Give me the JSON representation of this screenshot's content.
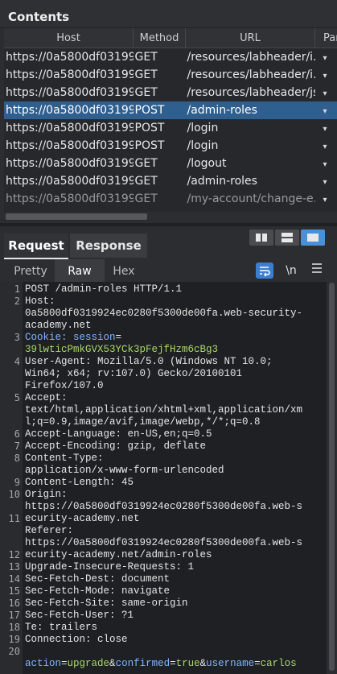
{
  "contents": {
    "title": "Contents",
    "columns": [
      "Host",
      "Method",
      "URL",
      "Par"
    ],
    "rows": [
      {
        "host": "https://0a5800df03199...",
        "method": "GET",
        "url": "/resources/labheader/i..."
      },
      {
        "host": "https://0a5800df03199...",
        "method": "GET",
        "url": "/resources/labheader/i..."
      },
      {
        "host": "https://0a5800df03199...",
        "method": "GET",
        "url": "/resources/labheader/js..."
      },
      {
        "host": "https://0a5800df03199...",
        "method": "POST",
        "url": "/admin-roles"
      },
      {
        "host": "https://0a5800df03199...",
        "method": "POST",
        "url": "/login"
      },
      {
        "host": "https://0a5800df03199...",
        "method": "POST",
        "url": "/login"
      },
      {
        "host": "https://0a5800df03199...",
        "method": "GET",
        "url": "/logout"
      },
      {
        "host": "https://0a5800df03199...",
        "method": "GET",
        "url": "/admin-roles"
      },
      {
        "host": "https://0a5800df03199...",
        "method": "GET",
        "url": "/my-account/change-e..."
      }
    ],
    "selected_row": 3
  },
  "tabs": {
    "request": "Request",
    "response": "Response"
  },
  "view": {
    "pretty": "Pretty",
    "raw": "Raw",
    "hex": "Hex",
    "newline_toggle": "\\n"
  },
  "request": {
    "line_numbers": [
      "1",
      "2",
      "",
      "",
      "3",
      "",
      "4",
      "",
      "",
      "5",
      "",
      "",
      "6",
      "7",
      "8",
      "",
      "9",
      "10",
      "",
      "11",
      "",
      "",
      "12",
      "13",
      "14",
      "15",
      "16",
      "17",
      "18",
      "19",
      "20"
    ],
    "lines": [
      [
        {
          "t": "POST /admin-roles HTTP/1.1"
        }
      ],
      [
        {
          "t": "Host:"
        }
      ],
      [
        {
          "t": "0a5800df0319924ec0280f5300de00fa.web-security-"
        }
      ],
      [
        {
          "t": "academy.net"
        }
      ],
      [
        {
          "t": "Cookie: ",
          "c": "k"
        },
        {
          "t": "session",
          "c": "k"
        },
        {
          "t": "="
        }
      ],
      [
        {
          "t": "39lwticPmkGVX53YCk3pFejfHzm6cBg3",
          "c": "g"
        }
      ],
      [
        {
          "t": "User-Agent: Mozilla/5.0 (Windows NT 10.0;"
        }
      ],
      [
        {
          "t": "Win64; x64; rv:107.0) Gecko/20100101"
        }
      ],
      [
        {
          "t": "Firefox/107.0"
        }
      ],
      [
        {
          "t": "Accept:"
        }
      ],
      [
        {
          "t": "text/html,application/xhtml+xml,application/xm"
        }
      ],
      [
        {
          "t": "l;q=0.9,image/avif,image/webp,*/*;q=0.8"
        }
      ],
      [
        {
          "t": "Accept-Language: en-US,en;q=0.5"
        }
      ],
      [
        {
          "t": "Accept-Encoding: gzip, deflate"
        }
      ],
      [
        {
          "t": "Content-Type:"
        }
      ],
      [
        {
          "t": "application/x-www-form-urlencoded"
        }
      ],
      [
        {
          "t": "Content-Length: 45"
        }
      ],
      [
        {
          "t": "Origin:"
        }
      ],
      [
        {
          "t": "https://0a5800df0319924ec0280f5300de00fa.web-s"
        }
      ],
      [
        {
          "t": "ecurity-academy.net"
        }
      ],
      [
        {
          "t": "Referer:"
        }
      ],
      [
        {
          "t": "https://0a5800df0319924ec0280f5300de00fa.web-s"
        }
      ],
      [
        {
          "t": "ecurity-academy.net/admin-roles"
        }
      ],
      [
        {
          "t": "Upgrade-Insecure-Requests: 1"
        }
      ],
      [
        {
          "t": "Sec-Fetch-Dest: document"
        }
      ],
      [
        {
          "t": "Sec-Fetch-Mode: navigate"
        }
      ],
      [
        {
          "t": "Sec-Fetch-Site: same-origin"
        }
      ],
      [
        {
          "t": "Sec-Fetch-User: ?1"
        }
      ],
      [
        {
          "t": "Te: trailers"
        }
      ],
      [
        {
          "t": "Connection: close"
        }
      ],
      [
        {
          "t": ""
        }
      ],
      [
        {
          "t": "action",
          "c": "k"
        },
        {
          "t": "="
        },
        {
          "t": "upgrade",
          "c": "g"
        },
        {
          "t": "&"
        },
        {
          "t": "confirmed",
          "c": "k"
        },
        {
          "t": "="
        },
        {
          "t": "true",
          "c": "g"
        },
        {
          "t": "&"
        },
        {
          "t": "username",
          "c": "k"
        },
        {
          "t": "="
        },
        {
          "t": "carlos",
          "c": "g"
        }
      ]
    ]
  },
  "colors": {
    "selected_row": "#2f5f8f",
    "key": "#7fb6ff",
    "value": "#a8d86a",
    "accent": "#4a90d9"
  }
}
